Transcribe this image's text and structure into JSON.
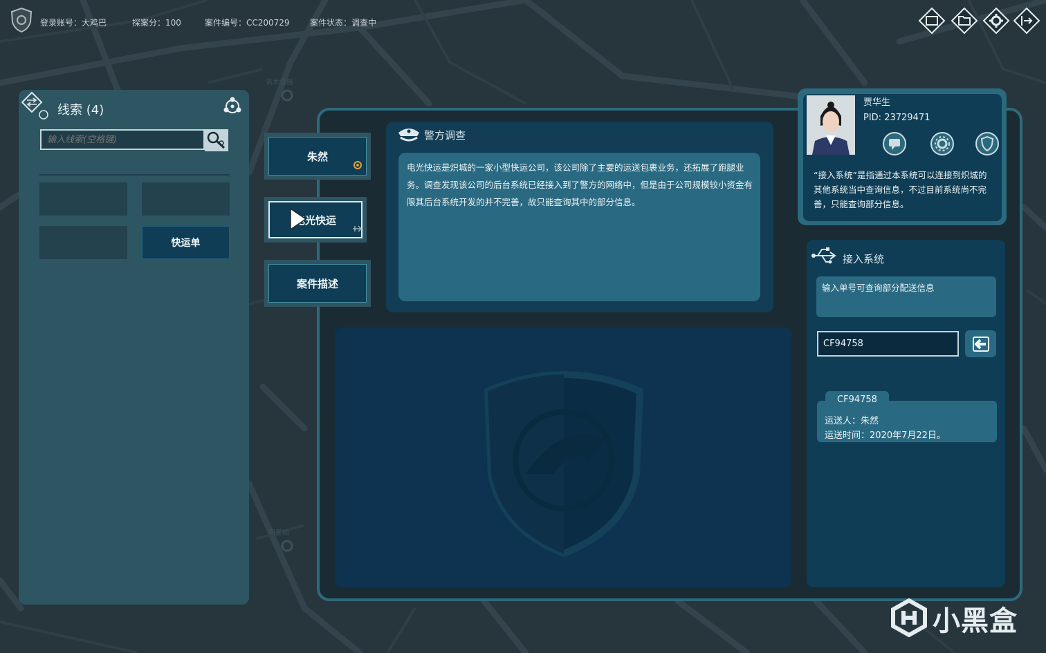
{
  "topbar": {
    "account_label": "登录账号：大鸡巴",
    "score_label": "探案分：100",
    "case_id_label": "案件编号：CC200729",
    "case_status_label": "案件状态：调查中"
  },
  "top_icons": [
    "window-icon",
    "folder-icon",
    "gear-icon",
    "exit-icon"
  ],
  "map_labels": [
    "筑木设施",
    "朝圣站"
  ],
  "clues": {
    "title": "线索 (4)",
    "search_placeholder": "输入线索(空格键)",
    "slots": [
      "",
      "",
      "",
      "快运单"
    ]
  },
  "side_tabs": [
    {
      "label": "朱然"
    },
    {
      "label": "电光快运"
    },
    {
      "label": "案件描述"
    }
  ],
  "police": {
    "title": "警方调查",
    "text": "电光快运是炽城的一家小型快运公司，该公司除了主要的运送包裹业务，还拓展了跑腿业务。调查发现该公司的后台系统已经接入到了警方的网络中，但是由于公司规模较小资金有限其后台系统开发的并不完善，故只能查询其中的部分信息。"
  },
  "profile": {
    "name": "贾华生",
    "pid": "PID: 23729471",
    "description": "“接入系统”是指通过本系统可以连接到炽城的其他系统当中查询信息，不过目前系统尚不完善，只能查询部分信息。"
  },
  "access": {
    "title": "接入系统",
    "hint": "输入单号可查询部分配送信息",
    "input_value": "CF94758",
    "result": {
      "tag": "CF94758",
      "sender": "运送人：朱然",
      "time": "运送时间：2020年7月22日。"
    }
  },
  "watermark": {
    "text": "小黑盒"
  },
  "colors": {
    "background": "#27353d",
    "panel": "#2e5562",
    "panel_dark": "#0f3d55",
    "accent": "#2a6982",
    "frame": "#2f6a7c"
  }
}
